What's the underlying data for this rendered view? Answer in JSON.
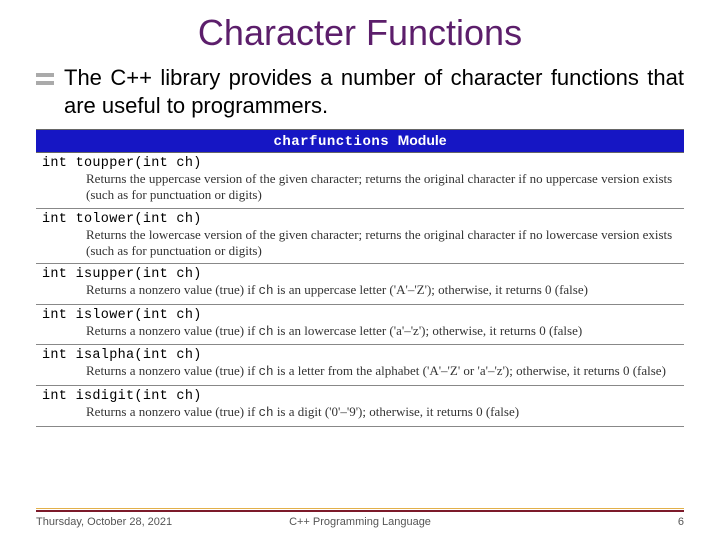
{
  "title": "Character Functions",
  "body": "The C++ library provides a number of character functions that are useful to programmers.",
  "module": {
    "name": "charfunctions",
    "label": "Module"
  },
  "functions": [
    {
      "sig": "int toupper(int ch)",
      "desc_pre": "Returns the uppercase version of the given character; returns the original character if no uppercase version exists (such as for punctuation or digits)",
      "desc_post": ""
    },
    {
      "sig": "int tolower(int ch)",
      "desc_pre": "Returns the lowercase version of the given character; returns the original character if no lowercase version exists (such as for punctuation or digits)",
      "desc_post": ""
    },
    {
      "sig": "int isupper(int ch)",
      "desc_pre": "Returns a nonzero value (true) if ",
      "desc_mid": "ch",
      "desc_post": " is an uppercase letter ('A'–'Z'); otherwise, it returns 0 (false)"
    },
    {
      "sig": "int islower(int ch)",
      "desc_pre": "Returns a nonzero value (true) if ",
      "desc_mid": "ch",
      "desc_post": " is an lowercase letter ('a'–'z'); otherwise, it returns 0 (false)"
    },
    {
      "sig": "int isalpha(int ch)",
      "desc_pre": "Returns a nonzero value (true) if ",
      "desc_mid": "ch",
      "desc_post": " is a letter from the alphabet ('A'–'Z' or 'a'–'z'); otherwise, it returns 0 (false)"
    },
    {
      "sig": "int isdigit(int ch)",
      "desc_pre": "Returns a nonzero value (true) if ",
      "desc_mid": "ch",
      "desc_post": " is a digit ('0'–'9'); otherwise, it returns 0 (false)"
    }
  ],
  "footer": {
    "date": "Thursday, October 28, 2021",
    "course": "C++ Programming Language",
    "page": "6"
  }
}
